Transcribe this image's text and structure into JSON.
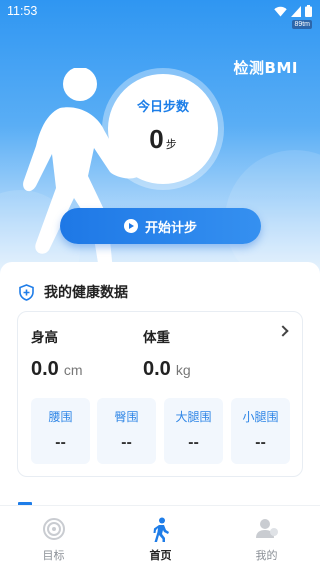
{
  "status_bar": {
    "time": "11:53",
    "battery_tag": "89tm"
  },
  "header": {
    "bmi_link": "检测BMI"
  },
  "steps": {
    "title": "今日步数",
    "value": "0",
    "unit": "步"
  },
  "start_button": {
    "label": "开始计步"
  },
  "health": {
    "title": "我的健康数据",
    "height": {
      "label": "身高",
      "value": "0.0",
      "unit": "cm"
    },
    "weight": {
      "label": "体重",
      "value": "0.0",
      "unit": "kg"
    },
    "measures": [
      {
        "label": "腰围",
        "value": "--"
      },
      {
        "label": "臀围",
        "value": "--"
      },
      {
        "label": "大腿围",
        "value": "--"
      },
      {
        "label": "小腿围",
        "value": "--"
      }
    ]
  },
  "tabbar": {
    "items": [
      {
        "label": "目标",
        "icon": "target-icon",
        "active": false
      },
      {
        "label": "首页",
        "icon": "walking-person-icon",
        "active": true
      },
      {
        "label": "我的",
        "icon": "profile-icon",
        "active": false
      }
    ]
  },
  "colors": {
    "primary": "#1e78e6",
    "accent_text": "#2f86e6",
    "card_tint": "#f2f7fd"
  }
}
